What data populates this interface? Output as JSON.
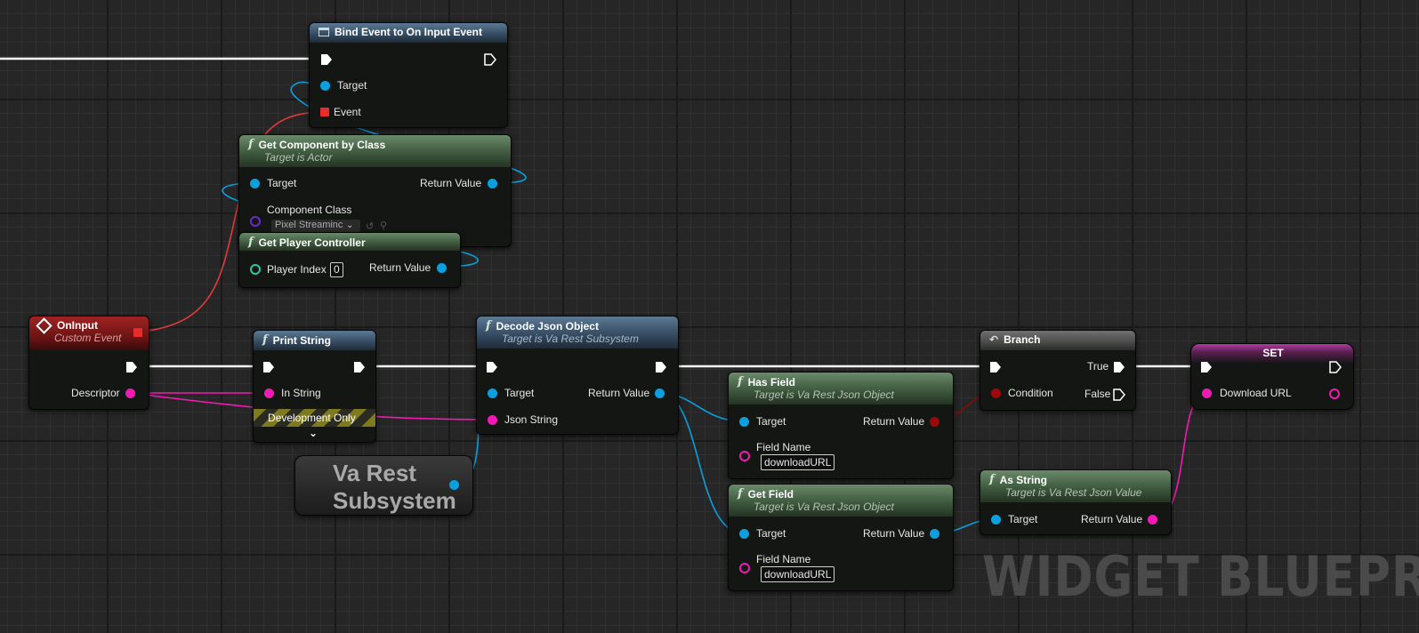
{
  "graph": {
    "watermark": "WIDGET BLUEPRIN",
    "nodes": {
      "bind_event": {
        "title": "Bind Event to On Input Event",
        "pins": {
          "target": "Target",
          "event": "Event"
        }
      },
      "get_component": {
        "title": "Get Component by Class",
        "subtitle": "Target is Actor",
        "pins": {
          "target": "Target",
          "return": "Return Value",
          "component_class": "Component Class"
        },
        "class_value": "Pixel Streaminc"
      },
      "get_player_controller": {
        "title": "Get Player Controller",
        "pins": {
          "player_index": "Player Index",
          "return": "Return Value"
        },
        "player_index_value": "0"
      },
      "on_input": {
        "title": "OnInput",
        "subtitle": "Custom Event",
        "pins": {
          "descriptor": "Descriptor"
        }
      },
      "print_string": {
        "title": "Print String",
        "pins": {
          "in_string": "In String"
        },
        "dev_only": "Development Only"
      },
      "decode_json": {
        "title": "Decode Json Object",
        "subtitle": "Target is Va Rest Subsystem",
        "pins": {
          "target": "Target",
          "return": "Return Value",
          "json_string": "Json String"
        }
      },
      "va_rest": {
        "title": "Va Rest Subsystem"
      },
      "has_field": {
        "title": "Has Field",
        "subtitle": "Target is Va Rest Json Object",
        "pins": {
          "target": "Target",
          "return": "Return Value",
          "field_name": "Field Name"
        },
        "field_value": "downloadURL"
      },
      "get_field": {
        "title": "Get Field",
        "subtitle": "Target is Va Rest Json Object",
        "pins": {
          "target": "Target",
          "return": "Return Value",
          "field_name": "Field Name"
        },
        "field_value": "downloadURL"
      },
      "branch": {
        "title": "Branch",
        "pins": {
          "condition": "Condition",
          "true": "True",
          "false": "False"
        }
      },
      "as_string": {
        "title": "As String",
        "subtitle": "Target is Va Rest Json Value",
        "pins": {
          "target": "Target",
          "return": "Return Value"
        }
      },
      "set": {
        "title": "SET",
        "pins": {
          "download_url": "Download URL"
        }
      }
    },
    "colors": {
      "exec_wire": "#ffffff",
      "object_pin": "#0aa0e0",
      "string_pin": "#f21ab4",
      "bool_pin": "#9a0a0a",
      "delegate_pin": "#e82b2b",
      "function_header": "#4f6b4f",
      "pure_header": "#3b5671",
      "event_header": "#8a1a1a"
    }
  }
}
